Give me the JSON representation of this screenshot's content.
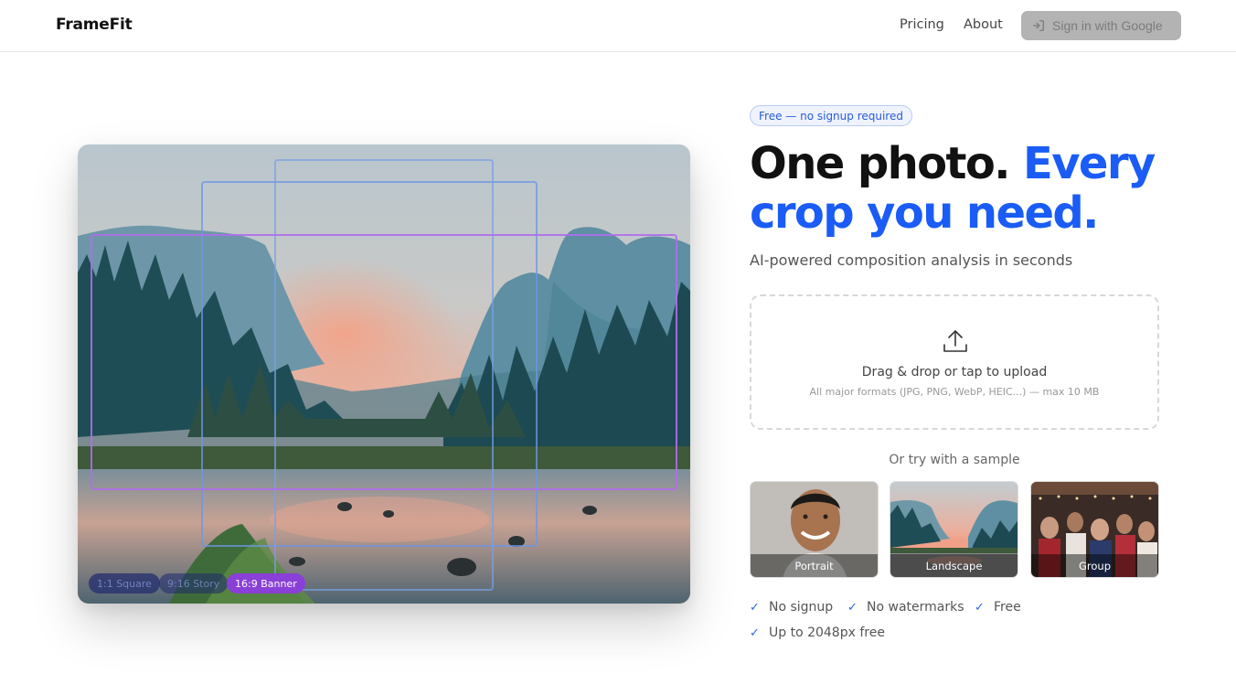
{
  "header": {
    "brand": "FrameFit",
    "nav": [
      {
        "label": "Pricing"
      },
      {
        "label": "About"
      }
    ],
    "signin_label": "Sign in with Google"
  },
  "hero": {
    "badge": "Free — no signup required",
    "headline_black": "One photo.",
    "headline_blue": "Every crop you need.",
    "subtitle": "AI-powered composition analysis in seconds",
    "crop_chips": [
      {
        "label": "1:1 Square"
      },
      {
        "label": "9:16 Story"
      },
      {
        "label": "16:9 Banner"
      }
    ]
  },
  "upload": {
    "title": "Drag & drop or tap to upload",
    "hint": "All major formats (JPG, PNG, WebP, HEIC...) — max 10 MB"
  },
  "samples": {
    "title": "Or try with a sample",
    "items": [
      {
        "label": "Portrait"
      },
      {
        "label": "Landscape"
      },
      {
        "label": "Group"
      }
    ]
  },
  "features": [
    {
      "label": "No signup"
    },
    {
      "label": "No watermarks"
    },
    {
      "label": "Free"
    },
    {
      "label": "Up to 2048px free"
    }
  ],
  "colors": {
    "accent_blue": "#1a5cf5",
    "banner_chip": "#8a3fd6",
    "check": "#2a67e0"
  },
  "icons": {
    "signin": "login-arrow-icon",
    "upload": "upload-icon",
    "check": "check-icon"
  }
}
